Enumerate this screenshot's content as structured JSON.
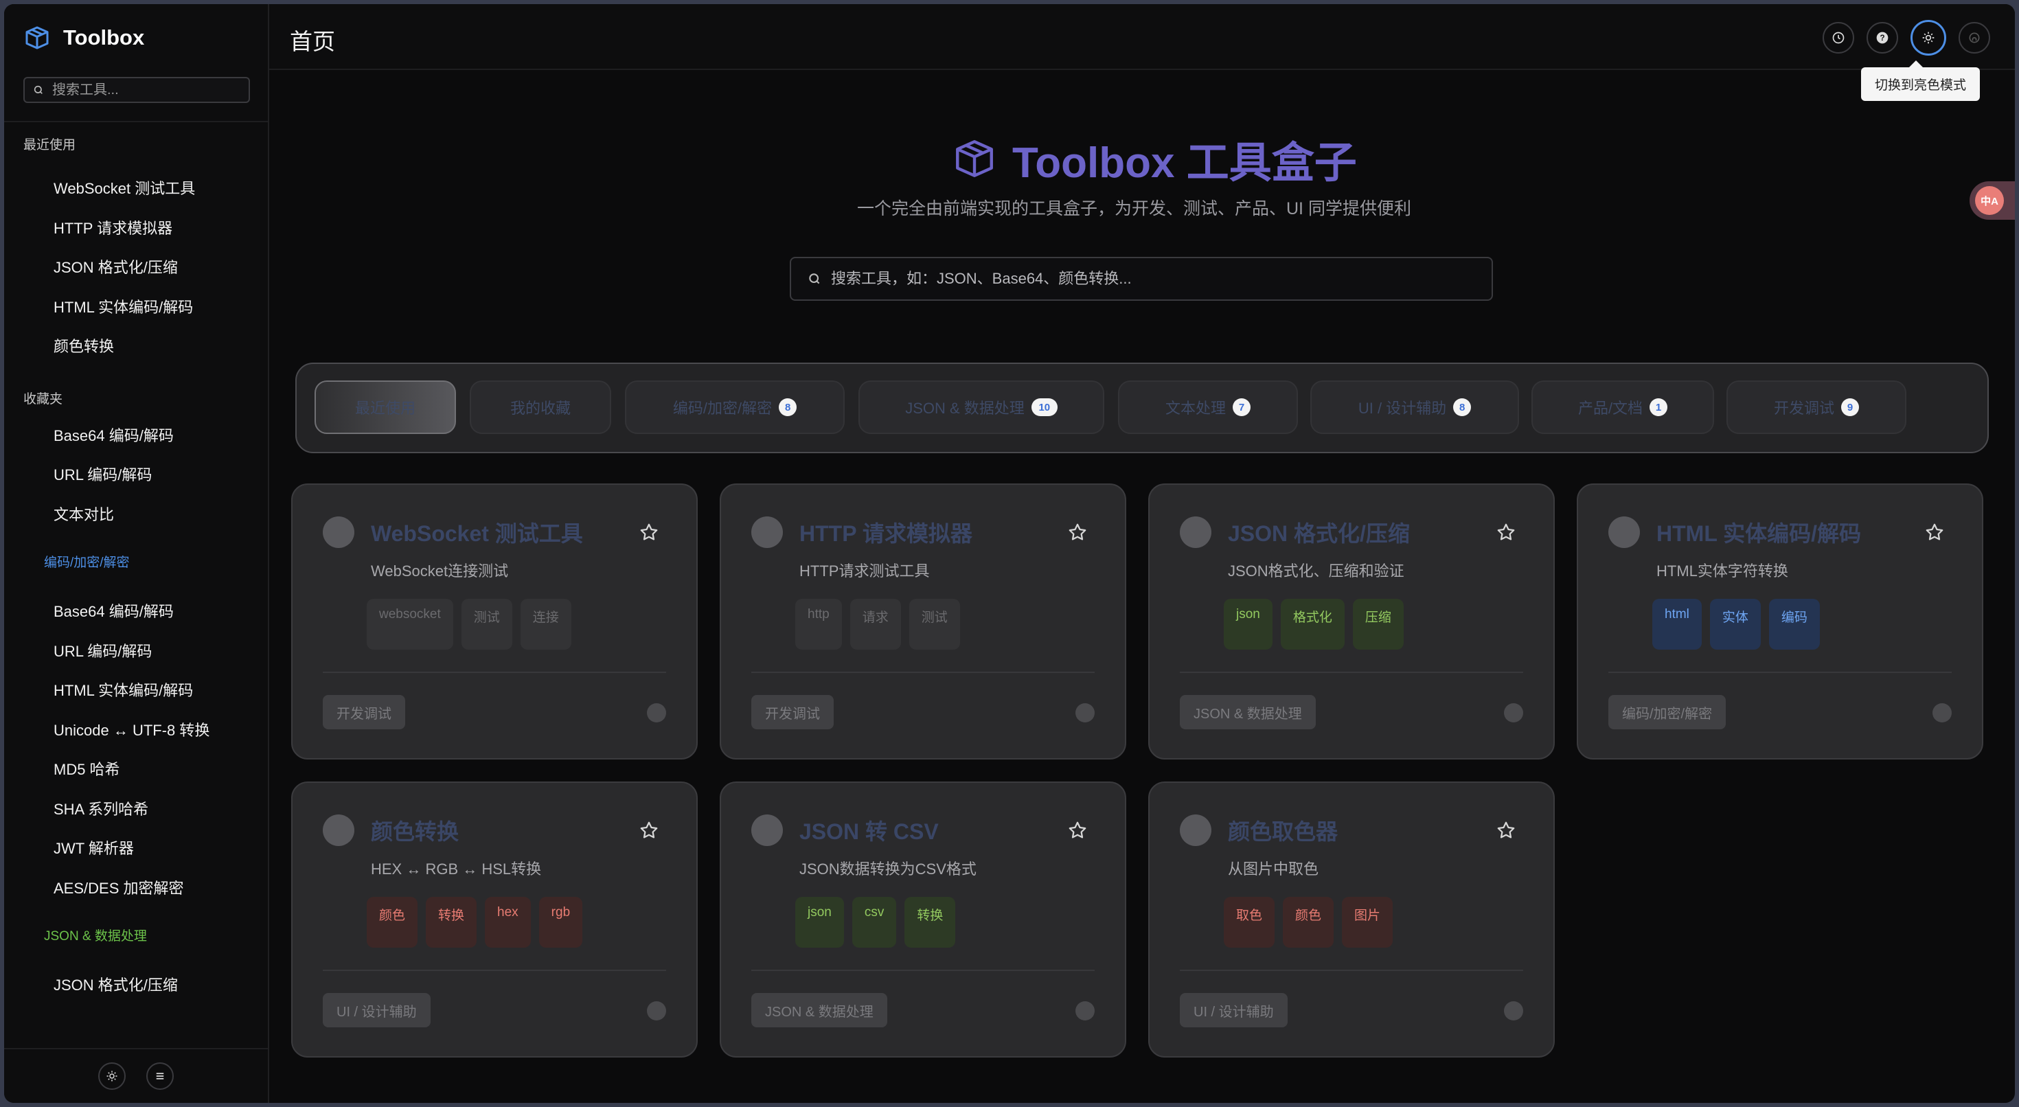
{
  "sidebar": {
    "brand": "Toolbox",
    "search_placeholder": "搜索工具...",
    "recent_title": "最近使用",
    "recent": [
      "WebSocket 测试工具",
      "HTTP 请求模拟器",
      "JSON 格式化/压缩",
      "HTML 实体编码/解码",
      "颜色转换"
    ],
    "favorites_title": "收藏夹",
    "favorites": [
      "Base64 编码/解码",
      "URL 编码/解码",
      "文本对比"
    ],
    "group1_title": "编码/加密/解密",
    "group1": [
      "Base64 编码/解码",
      "URL 编码/解码",
      "HTML 实体编码/解码",
      "Unicode ↔ UTF-8 转换",
      "MD5 哈希",
      "SHA 系列哈希",
      "JWT 解析器",
      "AES/DES 加密解密"
    ],
    "group2_title": "JSON & 数据处理",
    "group2": [
      "JSON 格式化/压缩"
    ]
  },
  "topbar": {
    "title": "首页",
    "tooltip": "切换到亮色模式"
  },
  "translate_badge": "中A",
  "hero": {
    "title": "Toolbox 工具盒子",
    "subtitle": "一个完全由前端实现的工具盒子，为开发、测试、产品、UI 同学提供便利",
    "search_placeholder": "搜索工具，如：JSON、Base64、颜色转换..."
  },
  "tabs": [
    {
      "label": "最近使用",
      "count": ""
    },
    {
      "label": "我的收藏",
      "count": ""
    },
    {
      "label": "编码/加密/解密",
      "count": "8"
    },
    {
      "label": "JSON & 数据处理",
      "count": "10"
    },
    {
      "label": "文本处理",
      "count": "7"
    },
    {
      "label": "UI / 设计辅助",
      "count": "8"
    },
    {
      "label": "产品/文档",
      "count": "1"
    },
    {
      "label": "开发调试",
      "count": "9"
    }
  ],
  "cards": [
    {
      "title": "WebSocket 测试工具",
      "desc": "WebSocket连接测试",
      "tags": [
        "websocket",
        "测试",
        "连接"
      ],
      "tag_color": "gray",
      "category": "开发调试"
    },
    {
      "title": "HTTP 请求模拟器",
      "desc": "HTTP请求测试工具",
      "tags": [
        "http",
        "请求",
        "测试"
      ],
      "tag_color": "gray",
      "category": "开发调试"
    },
    {
      "title": "JSON 格式化/压缩",
      "desc": "JSON格式化、压缩和验证",
      "tags": [
        "json",
        "格式化",
        "压缩"
      ],
      "tag_color": "green",
      "category": "JSON & 数据处理"
    },
    {
      "title": "HTML 实体编码/解码",
      "desc": "HTML实体字符转换",
      "tags": [
        "html",
        "实体",
        "编码"
      ],
      "tag_color": "blue",
      "category": "编码/加密/解密"
    },
    {
      "title": "颜色转换",
      "desc": "HEX ↔ RGB ↔ HSL转换",
      "tags": [
        "颜色",
        "转换",
        "hex",
        "rgb"
      ],
      "tag_color": "red",
      "category": "UI / 设计辅助"
    },
    {
      "title": "JSON 转 CSV",
      "desc": "JSON数据转换为CSV格式",
      "tags": [
        "json",
        "csv",
        "转换"
      ],
      "tag_color": "green",
      "category": "JSON & 数据处理"
    },
    {
      "title": "颜色取色器",
      "desc": "从图片中取色",
      "tags": [
        "取色",
        "颜色",
        "图片"
      ],
      "tag_color": "red",
      "category": "UI / 设计辅助"
    }
  ]
}
